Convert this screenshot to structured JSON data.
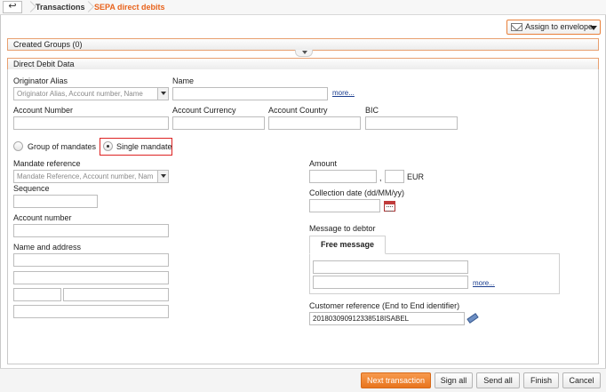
{
  "breadcrumb": {
    "back_icon": "back-arrow-icon",
    "items": [
      "Transactions",
      "SEPA direct debits"
    ],
    "active_color": "#e8631c"
  },
  "assign": {
    "label": "Assign to envelope",
    "icon": "envelope-icon"
  },
  "sections": {
    "created_groups": "Created Groups (0)",
    "direct_debit_data": "Direct Debit Data"
  },
  "originator": {
    "alias_label": "Originator Alias",
    "alias_placeholder": "Originator Alias, Account number, Name",
    "name_label": "Name",
    "more_link": "more...",
    "account_number_label": "Account Number",
    "account_currency_label": "Account Currency",
    "account_country_label": "Account Country",
    "bic_label": "BIC"
  },
  "mandate_type": {
    "group_label": "Group of mandates",
    "single_label": "Single mandate",
    "selected": "single"
  },
  "mandate": {
    "reference_label": "Mandate reference",
    "reference_placeholder": "Mandate Reference, Account number, Nam",
    "sequence_label": "Sequence",
    "account_number_label": "Account number",
    "name_address_label": "Name and address"
  },
  "payment": {
    "amount_label": "Amount",
    "decimal_sep": ",",
    "currency": "EUR",
    "collection_date_label": "Collection date (dd/MM/yy)",
    "message_label": "Message to debtor",
    "free_message_tab": "Free message",
    "more_link": "more...",
    "customer_ref_label": "Customer reference (End to End identifier)",
    "customer_ref_value": "20180309091233851​8ISABEL"
  },
  "footer": {
    "next_label": "Next transaction",
    "sign_all_label": "Sign all",
    "send_all_label": "Send all",
    "finish_label": "Finish",
    "cancel_label": "Cancel"
  }
}
